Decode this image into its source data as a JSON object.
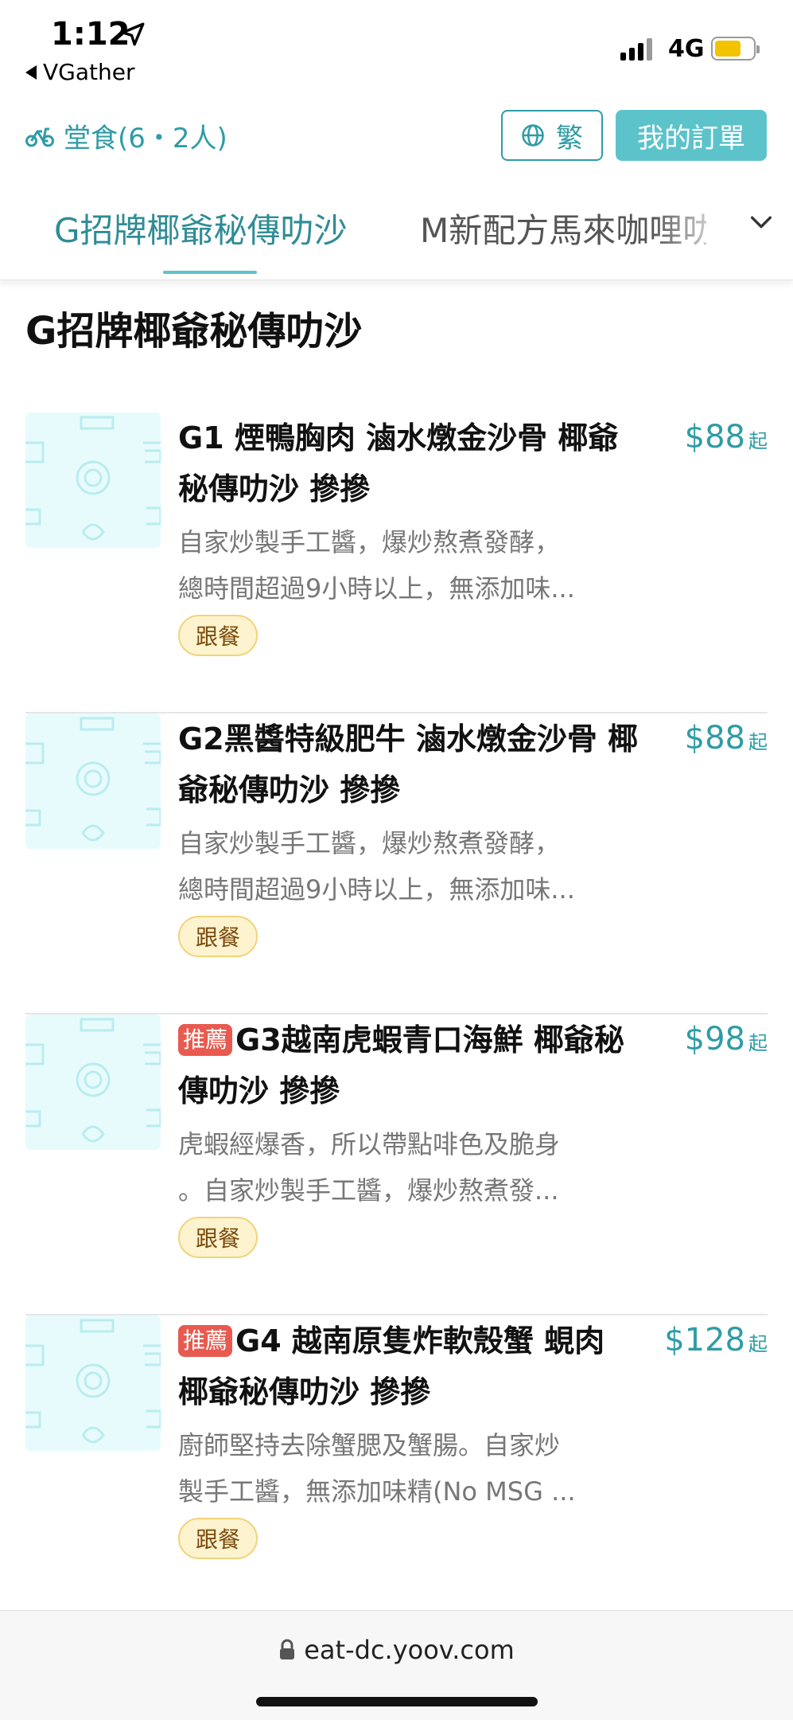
{
  "status_bar": {
    "time": "1:12",
    "back_app": "VGather",
    "network": "4G"
  },
  "header": {
    "dine_mode": "堂食(6・2人)",
    "language_label": "繁",
    "my_orders_label": "我的訂單"
  },
  "tabs": {
    "active": "G招牌椰爺秘傳叻沙",
    "next": "M新配方馬來咖哩叻"
  },
  "section": {
    "title": "G招牌椰爺秘傳叻沙"
  },
  "items": [
    {
      "badge": "",
      "name": "G1 煙鴨胸肉 滷水燉金沙骨 椰爺秘傳叻沙 摻摻",
      "price": "$88",
      "price_suffix": "起",
      "desc_line1": "自家炒製手工醬，爆炒熬煮發酵，",
      "desc_line2": "總時間超過9小時以上，無添加味...",
      "tag": "跟餐"
    },
    {
      "badge": "",
      "name": "G2黑醬特級肥牛 滷水燉金沙骨 椰爺秘傳叻沙 摻摻",
      "price": "$88",
      "price_suffix": "起",
      "desc_line1": "自家炒製手工醬，爆炒熬煮發酵，",
      "desc_line2": "總時間超過9小時以上，無添加味...",
      "tag": "跟餐"
    },
    {
      "badge": "推薦",
      "name": "G3越南虎蝦青口海鮮 椰爺秘傳叻沙 摻摻",
      "price": "$98",
      "price_suffix": "起",
      "desc_line1": "虎蝦經爆香，所以帶點啡色及脆身",
      "desc_line2": "。自家炒製手工醬，爆炒熬煮發...",
      "tag": "跟餐"
    },
    {
      "badge": "推薦",
      "name": "G4 越南原隻炸軟殼蟹 蜆肉 椰爺秘傳叻沙 摻摻",
      "price": "$128",
      "price_suffix": "起",
      "desc_line1": "廚師堅持去除蟹腮及蟹腸。自家炒",
      "desc_line2": "製手工醬，無添加味精(No MSG ...",
      "tag": "跟餐"
    }
  ],
  "browser": {
    "url": "eat-dc.yoov.com"
  },
  "colors": {
    "accent": "#2f9ca6",
    "button_fill": "#5cc3cb",
    "recommend": "#e85a4f",
    "tag_bg": "#fdf3cf"
  }
}
